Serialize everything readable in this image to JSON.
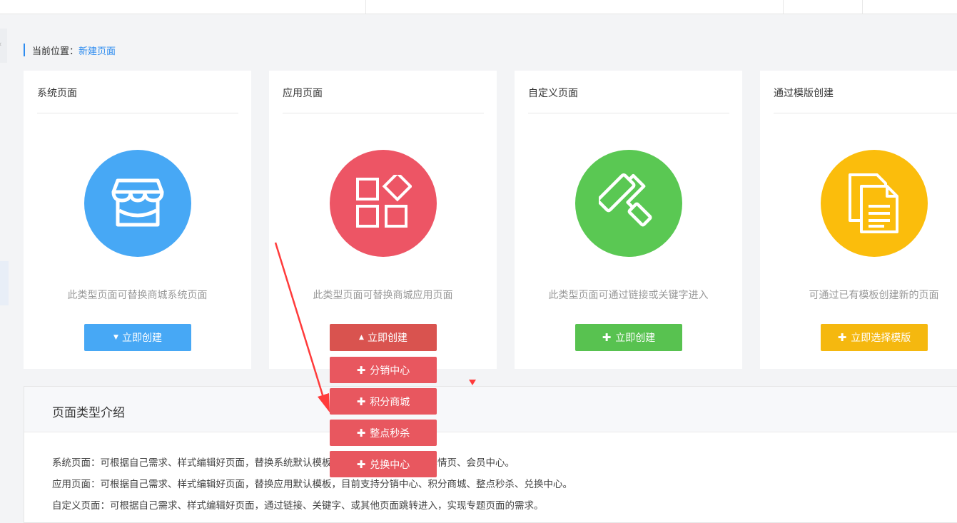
{
  "breadcrumb": {
    "label": "当前位置：",
    "current": "新建页面"
  },
  "cards": [
    {
      "title": "系统页面",
      "icon": "store-icon",
      "color": "#47a8f5",
      "desc": "此类型页面可替换商城系统页面",
      "button": "立即创建",
      "button_color": "#47a8f5",
      "button_icon": "caret-down-icon"
    },
    {
      "title": "应用页面",
      "icon": "apps-grid-icon",
      "color": "#ed5565",
      "desc": "此类型页面可替换商城应用页面",
      "button": "立即创建",
      "button_color": "#d9534f",
      "button_icon": "caret-up-icon"
    },
    {
      "title": "自定义页面",
      "icon": "paint-roller-icon",
      "color": "#5ac853",
      "desc": "此类型页面可通过链接或关键字进入",
      "button": "立即创建",
      "button_color": "#58c250",
      "button_icon": "plus-icon"
    },
    {
      "title": "通过模版创建",
      "icon": "documents-icon",
      "color": "#fbbd0c",
      "desc": "可通过已有模板创建新的页面",
      "button": "立即选择模版",
      "button_color": "#f5b80f",
      "button_icon": "plus-icon"
    }
  ],
  "dropdown": {
    "items": [
      "分销中心",
      "积分商城",
      "整点秒杀",
      "兑换中心"
    ]
  },
  "intro": {
    "title": "页面类型介绍",
    "lines": [
      "系统页面：可根据自己需求、样式编辑好页面，替换系统默认模板，目前支持首页、商品详情页、会员中心。",
      "应用页面：可根据自己需求、样式编辑好页面，替换应用默认模板，目前支持分销中心、积分商城、整点秒杀、兑换中心。",
      "自定义页面：可根据自己需求、样式编辑好页面，通过链接、关键字、或其他页面跳转进入，实现专题页面的需求。"
    ]
  },
  "colors": {
    "accent": "#2d8cf0",
    "annotation_arrow": "#ff3b3b"
  }
}
